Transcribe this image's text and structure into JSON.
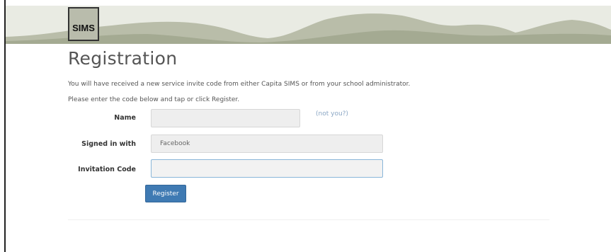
{
  "app": {
    "logo_text": "SIMS"
  },
  "page": {
    "title": "Registration",
    "intro_line1": "You will have received a new service invite code from either Capita SIMS or from your school administrator.",
    "intro_line2": "Please enter the code below and tap or click Register."
  },
  "form": {
    "name": {
      "label": "Name",
      "value": "",
      "link_text": "(not you?)"
    },
    "signed_in_with": {
      "label": "Signed in with",
      "value": "Facebook"
    },
    "invitation_code": {
      "label": "Invitation Code",
      "value": ""
    },
    "register_label": "Register"
  },
  "colors": {
    "primary_button": "#3f7ab3",
    "link": "#8aa6c4",
    "banner_mountains": "#a9ae99"
  }
}
